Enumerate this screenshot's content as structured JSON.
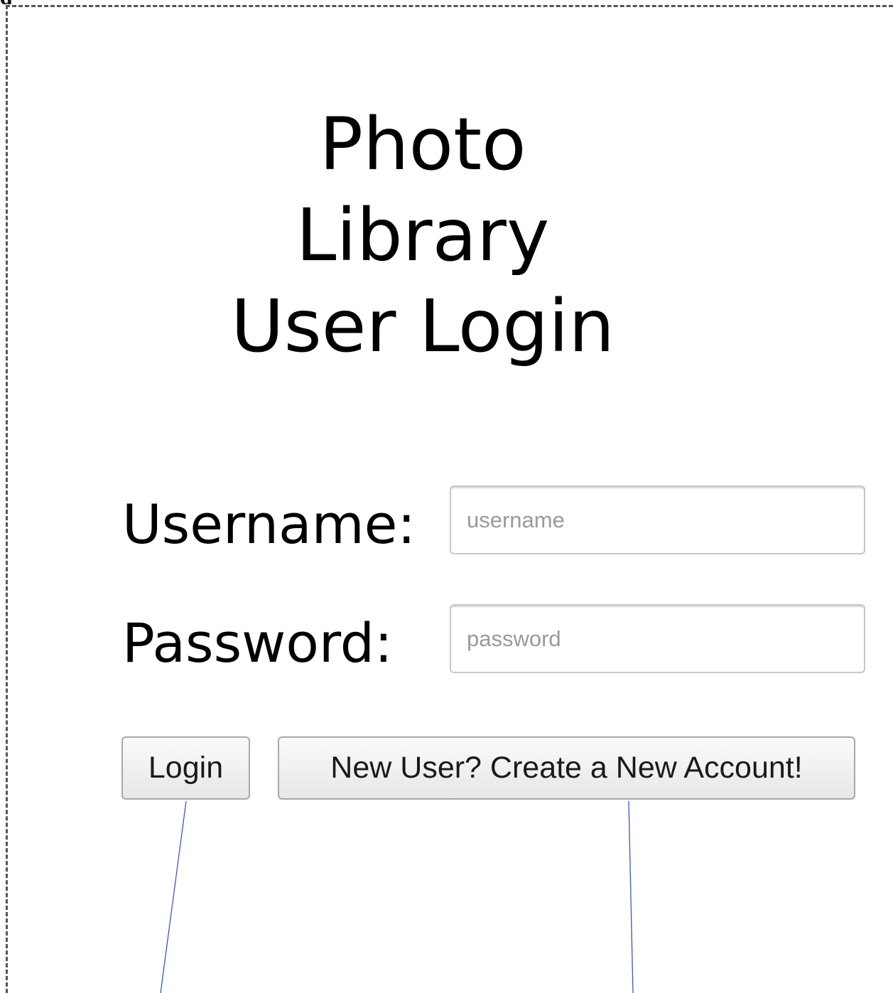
{
  "header": {
    "corner_text": "g"
  },
  "title": {
    "line1": "Photo",
    "line2": "Library",
    "line3": "User Login"
  },
  "form": {
    "username_label": "Username:",
    "username_placeholder": "username",
    "username_value": "",
    "password_label": "Password:",
    "password_placeholder": "password",
    "password_value": ""
  },
  "buttons": {
    "login_label": "Login",
    "create_account_label": "New User? Create a New Account!"
  },
  "colors": {
    "leader_line": "#3a56c8",
    "frame": "#555555"
  }
}
